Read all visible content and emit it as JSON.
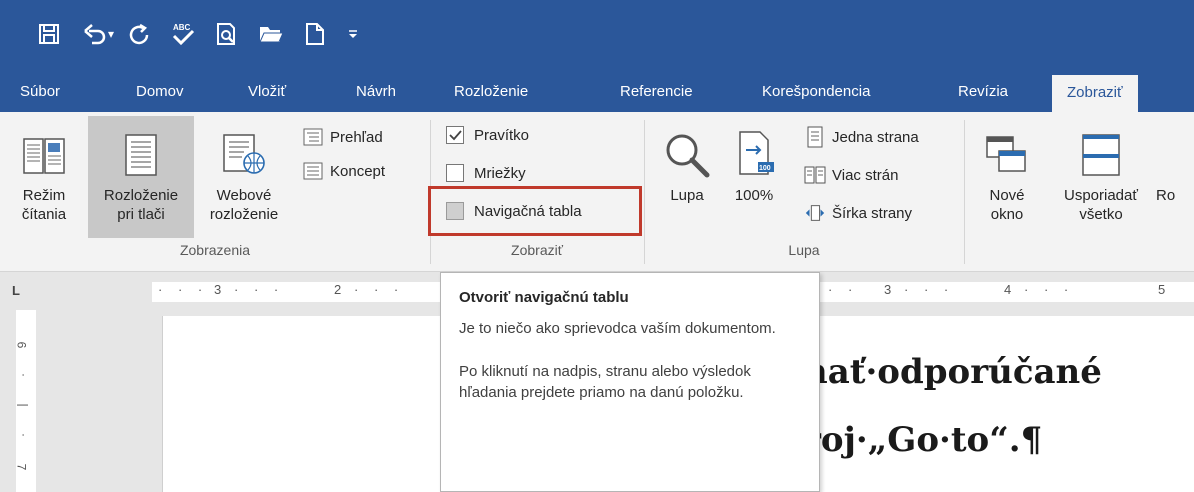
{
  "qat": {
    "icons": [
      "save-icon",
      "undo-icon",
      "redo-icon",
      "spelling-icon",
      "print-preview-icon",
      "open-icon",
      "new-document-icon",
      "customize-icon"
    ],
    "undo_dropdown": "▾"
  },
  "tabs": [
    "Súbor",
    "Domov",
    "Vložiť",
    "Návrh",
    "Rozloženie",
    "Referencie",
    "Korešpondencia",
    "Revízia",
    "Zobraziť"
  ],
  "active_tab": "Zobraziť",
  "ribbon": {
    "views": {
      "group_label": "Zobrazenia",
      "read_mode": [
        "Režim",
        "čítania"
      ],
      "print_layout": [
        "Rozloženie",
        "pri tlači"
      ],
      "web_layout": [
        "Webové",
        "rozloženie"
      ],
      "outline": "Prehľad",
      "draft": "Koncept"
    },
    "show": {
      "group_label": "Zobraziť",
      "ruler": "Pravítko",
      "ruler_checked": true,
      "gridlines": "Mriežky",
      "gridlines_checked": false,
      "nav_pane": "Navigačná tabla",
      "nav_pane_checked": false
    },
    "zoom": {
      "group_label": "Lupa",
      "zoom": "Lupa",
      "hundred_badge": "100",
      "hundred": "100%",
      "one_page": "Jedna strana",
      "multi_page": "Viac strán",
      "page_width": "Šírka strany"
    },
    "window": {
      "new_window": [
        "Nové",
        "okno"
      ],
      "arrange_all": [
        "Usporiadať",
        "všetko"
      ],
      "more": "Ro"
    }
  },
  "ruler": {
    "corner": "L",
    "h_ticks_left": [
      "3",
      "2"
    ],
    "h_ticks_right": [
      "3",
      "4",
      "5"
    ],
    "v_ticks": [
      "6",
      "7"
    ]
  },
  "document": {
    "line1": "nať·odporúčané",
    "line2": "roj·„Go·to“.¶"
  },
  "tooltip": {
    "title": "Otvoriť navigačnú tablu",
    "p1": "Je to niečo ako sprievodca vaším dokumentom.",
    "p2": "Po kliknutí na nadpis, stranu alebo výsledok hľadania prejdete priamo na danú položku."
  },
  "colors": {
    "ribbon_blue": "#2b579a",
    "ribbon_bg": "#f3f3f3",
    "highlight_red": "#c0392b"
  }
}
